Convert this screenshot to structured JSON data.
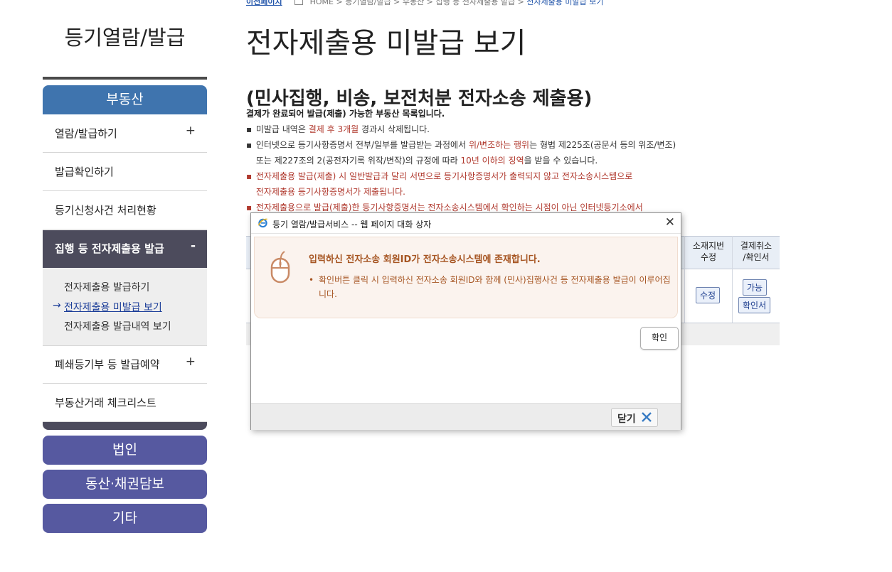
{
  "top": {
    "back": "이전페이지",
    "crumbs": "HOME > 등기열람/발급 > 부동산 > 집행 등 전자제출용 발급 > ",
    "current": "전자제출용 미발급 보기"
  },
  "sidebar": {
    "title": "등기열람/발급",
    "section": "부동산",
    "items": [
      {
        "label": "열람/발급하기",
        "toggle": "+"
      },
      {
        "label": "발급확인하기"
      },
      {
        "label": "등기신청사건 처리현황"
      },
      {
        "label": "집행 등 전자제출용 발급",
        "toggle": "-"
      },
      {
        "label": "폐쇄등기부 등 발급예약",
        "toggle": "+"
      },
      {
        "label": "부동산거래 체크리스트"
      }
    ],
    "submenu": [
      "전자제출용 발급하기",
      "전자제출용 미발급 보기",
      "전자제출용 발급내역 보기"
    ],
    "submenu_arrow": "→",
    "categories": [
      "법인",
      "동산·채권담보",
      "기타"
    ]
  },
  "main": {
    "title": "전자제출용 미발급 보기",
    "section_title": "(민사집행, 비송, 보전처분 전자소송 제출용)",
    "section_sub": "결제가 완료되어 발급(제출) 가능한 부동산 목록입니다.",
    "notes": {
      "n1": {
        "pre": "미발급 내역은 ",
        "red": "결제 후 3개월",
        "post": " 경과시 삭제됩니다."
      },
      "n2": {
        "pre": "인터넷으로 등기사항증명서 전부/일부를 발급받는 과정에서 ",
        "red": "위/변조하는 행위",
        "post": "는 형법 제225조(공문서 등의 위조/변조)"
      },
      "n3": {
        "pre": "또는 제227조의 2(공전자기록 위작/변작)의 규정에 따라 ",
        "red": "10년 이하의 징역",
        "post": "을 받을 수 있습니다."
      },
      "n4": "전자제출용 발급(제출) 시 일반발급과 달리 서면으로 등기사항증명서가 출력되지 않고 전자소송시스템으로",
      "n5": "전자제출용 등기사항증명서가 제출됩니다.",
      "n6": "전자제출용으로 발급(제출)한 등기사항증명서는 전자소송시스템에서 확인하는 시점이 아닌 인터넷등기소에서"
    },
    "bullet": "▪",
    "table": {
      "col_location": "소재지번\n수정",
      "col_cancel": "결제취소\n/확인서",
      "btn_edit": "수정",
      "btn_possible": "가능",
      "btn_confirm": "확인서"
    }
  },
  "dialog": {
    "title": "등기 열람/발급서비스 -- 웹 페이지 대화 상자",
    "close_glyph": "✕",
    "message_head": "입력하신 전자소송 회원ID가 전자소송시스템에 존재합니다.",
    "message_body": "확인버튼 클릭 시 입력하신 전자소송 회원ID와 함께 (민사)집행사건 등 전자제출용 발급이 이루어집니다.",
    "message_bullet": "•",
    "ok_label": "확인",
    "close_label": "닫기"
  },
  "colors": {
    "primary_blue": "#3f74ae",
    "category_purple": "#5659a0",
    "active_dark": "#4c4b5c",
    "warning_red": "#b0392e",
    "message_brown": "#a65522"
  }
}
